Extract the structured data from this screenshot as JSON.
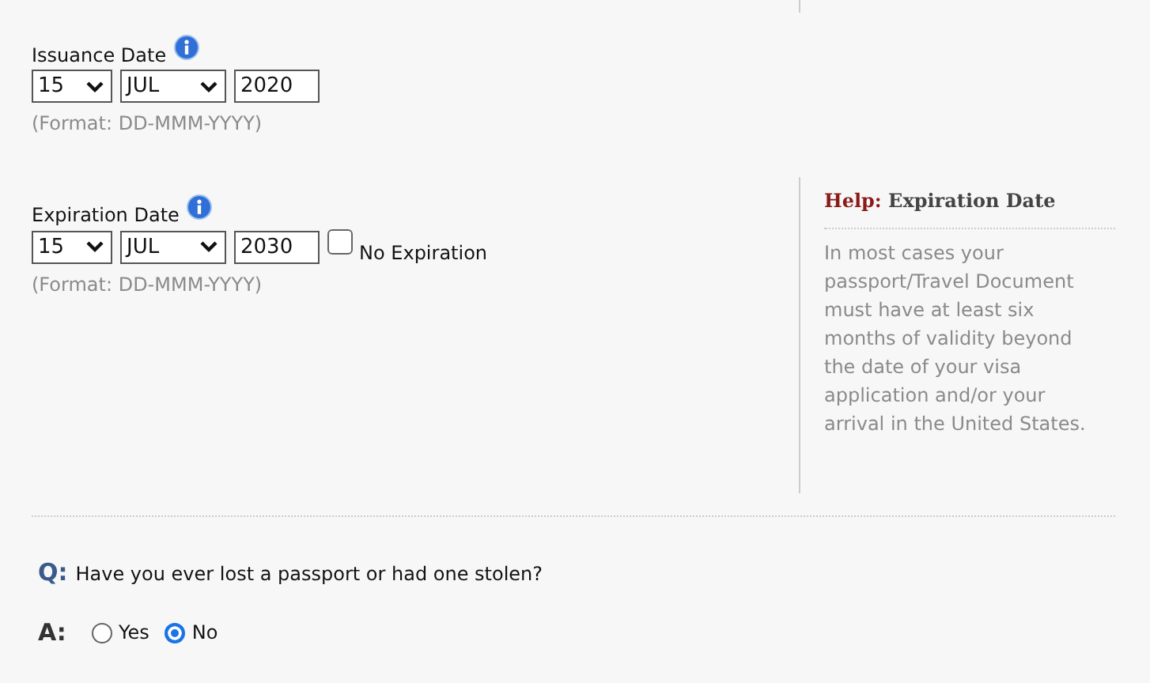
{
  "dates": [
    {
      "label": "Issuance Date",
      "day": "15",
      "month": "JUL",
      "year": "2020",
      "format": "(Format: DD-MMM-YYYY)"
    },
    {
      "label": "Expiration Date",
      "day": "15",
      "month": "JUL",
      "year": "2030",
      "format": "(Format: DD-MMM-YYYY)",
      "no_expiration": {
        "label": "No Expiration",
        "checked": false
      }
    }
  ],
  "help": {
    "label": "Help:",
    "title": "Expiration Date",
    "text": "In most cases your passport/Travel Document must have at least six months of validity beyond the date of your visa application and/or your arrival in the United States."
  },
  "question": {
    "prefix": "Q:",
    "text": "Have you ever lost a passport or had one stolen?",
    "answer_prefix": "A:",
    "options": [
      {
        "label": "Yes",
        "selected": false
      },
      {
        "label": "No",
        "selected": true
      }
    ]
  }
}
